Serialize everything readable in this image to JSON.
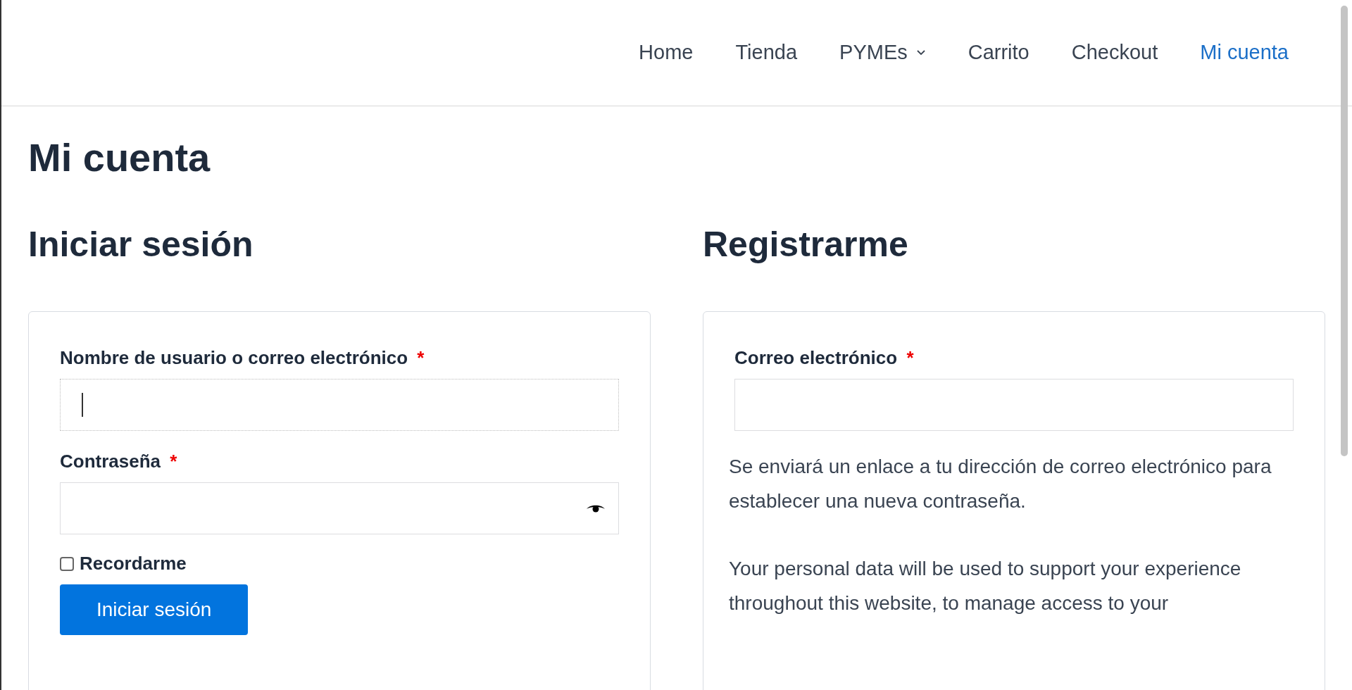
{
  "nav": {
    "items": [
      {
        "label": "Home",
        "selected": false,
        "has_dropdown": false
      },
      {
        "label": "Tienda",
        "selected": false,
        "has_dropdown": false
      },
      {
        "label": "PYMEs",
        "selected": false,
        "has_dropdown": true
      },
      {
        "label": "Carrito",
        "selected": false,
        "has_dropdown": false
      },
      {
        "label": "Checkout",
        "selected": false,
        "has_dropdown": false
      },
      {
        "label": "Mi cuenta",
        "selected": true,
        "has_dropdown": false
      }
    ]
  },
  "page_title": "Mi cuenta",
  "login": {
    "heading": "Iniciar sesión",
    "fields": [
      {
        "label": "Nombre de usuario o correo electrónico",
        "required_mark": "*",
        "kind": "text",
        "focused": true
      },
      {
        "label": "Contraseña",
        "required_mark": "*",
        "kind": "password",
        "focused": false
      }
    ],
    "remember": {
      "label": "Recordarme",
      "checked": false
    },
    "submit": "Iniciar sesión"
  },
  "register": {
    "heading": "Registrarme",
    "fields": [
      {
        "label": "Correo electrónico",
        "required_mark": "*",
        "focused": false
      }
    ],
    "notes": [
      "Se enviará un enlace a tu dirección de correo electrónico para establecer una nueva contraseña.",
      "Your personal data will be used to support your experience throughout this website, to manage access to your"
    ]
  }
}
